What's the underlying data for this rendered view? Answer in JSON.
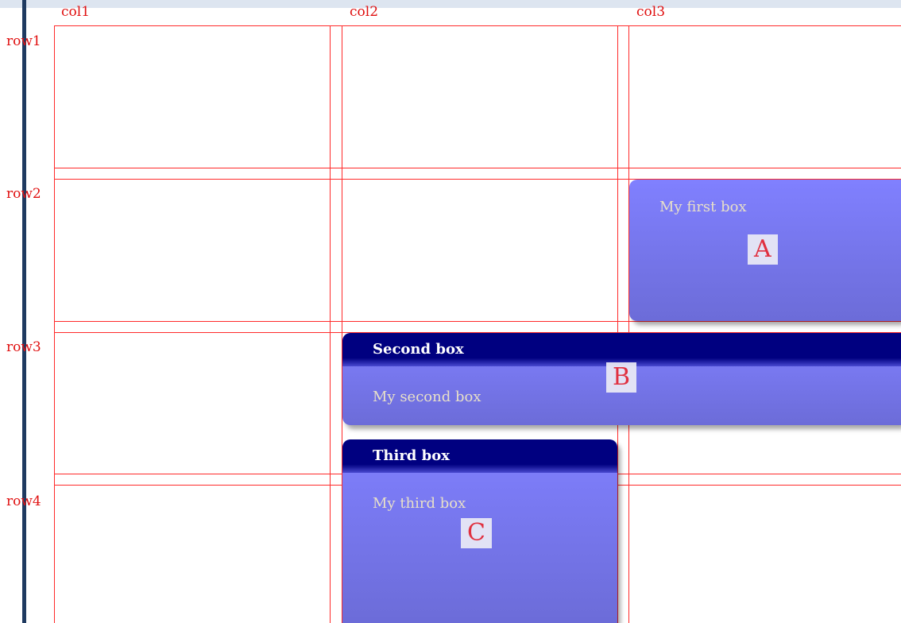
{
  "grid": {
    "columns": [
      "col1",
      "col2",
      "col3"
    ],
    "rows": [
      "row1",
      "row2",
      "row3",
      "row4"
    ]
  },
  "boxes": {
    "first": {
      "title": "",
      "text": "My first box",
      "tag": "A"
    },
    "second": {
      "title": "Second box",
      "text": "My second box",
      "tag": "B"
    },
    "third": {
      "title": "Third box",
      "text": "My third box",
      "tag": "C"
    }
  }
}
